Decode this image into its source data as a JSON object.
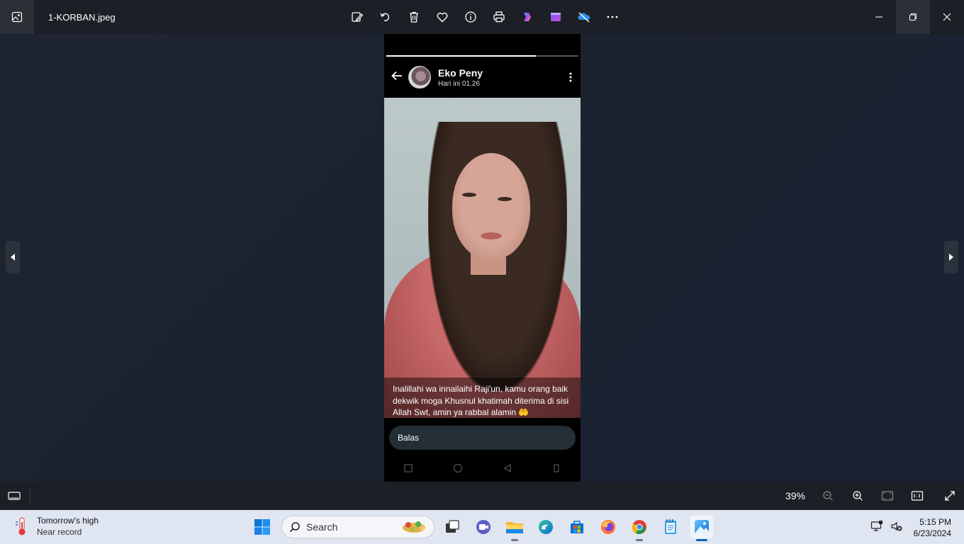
{
  "window": {
    "title": "1-KORBAN.jpeg",
    "toolbar": [
      "edit-image-icon",
      "rotate-icon",
      "delete-icon",
      "favorite-icon",
      "info-icon",
      "print-icon",
      "copilot-icon",
      "clipchamp-icon",
      "onedrive-icon",
      "more-icon"
    ]
  },
  "status": {
    "contact_name": "Eko Peny",
    "time": "Hari ini 01.26",
    "caption": "Inalillahi wa innailaihi Raji'un, kamu orang baik dekwik moga Khusnul khatimah diterima di sisi Allah Swt, amin ya rabbal alamin 🤲",
    "reply_placeholder": "Balas",
    "progress": 0.78
  },
  "viewer": {
    "zoom": "39%"
  },
  "taskbar": {
    "weather_title": "Tomorrow's high",
    "weather_sub": "Near record",
    "search_label": "Search",
    "time": "5:15 PM",
    "date": "6/23/2024"
  }
}
